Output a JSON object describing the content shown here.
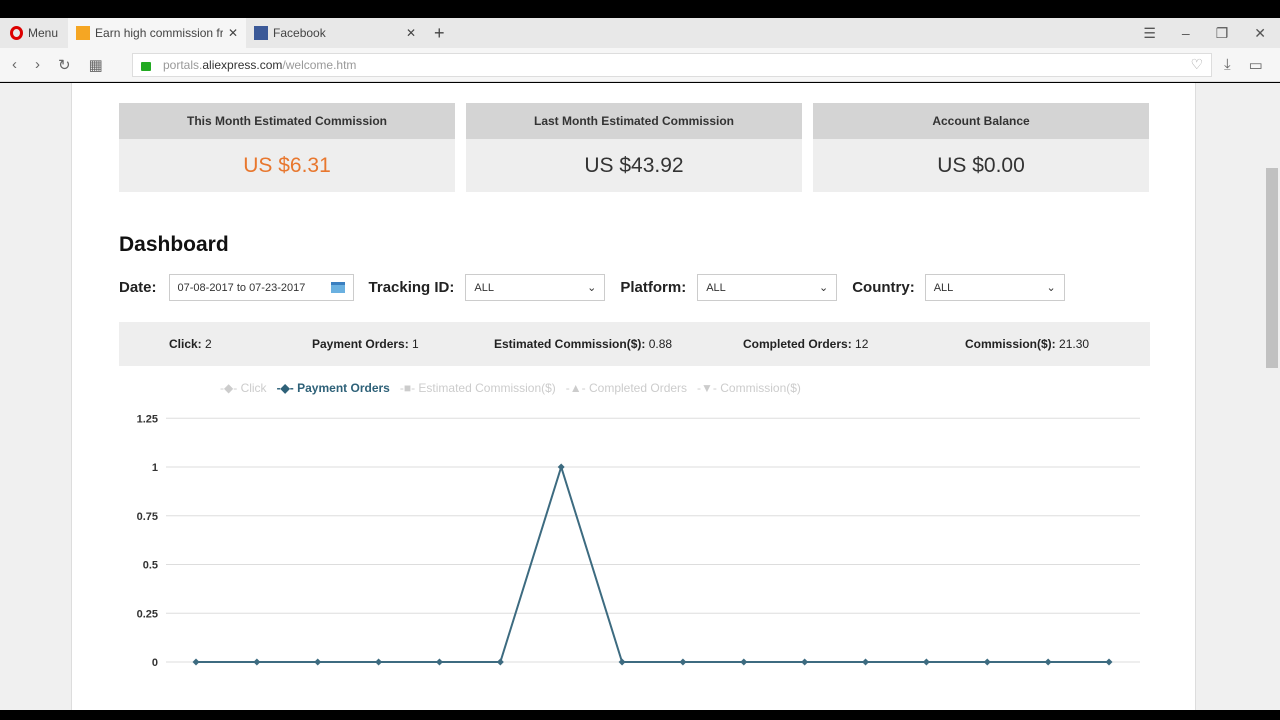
{
  "browser": {
    "menu_label": "Menu",
    "tabs": [
      {
        "title": "Earn high commission from",
        "active": true
      },
      {
        "title": "Facebook",
        "active": false
      }
    ],
    "url_prefix": "portals.",
    "url_domain": "aliexpress.com",
    "url_path": "/welcome.htm"
  },
  "cards": [
    {
      "title": "This Month Estimated Commission",
      "value": "US $6.31",
      "color": "#e8772e"
    },
    {
      "title": "Last Month Estimated Commission",
      "value": "US $43.92",
      "color": "#333333"
    },
    {
      "title": "Account Balance",
      "value": "US $0.00",
      "color": "#333333"
    }
  ],
  "dashboard": {
    "title": "Dashboard",
    "filters": {
      "date_label": "Date:",
      "date_value": "07-08-2017 to 07-23-2017",
      "tracking_label": "Tracking ID:",
      "tracking_value": "ALL",
      "platform_label": "Platform:",
      "platform_value": "ALL",
      "country_label": "Country:",
      "country_value": "ALL"
    },
    "stats": [
      {
        "label": "Click:",
        "value": "2"
      },
      {
        "label": "Payment Orders:",
        "value": "1"
      },
      {
        "label": "Estimated Commission($):",
        "value": "0.88"
      },
      {
        "label": "Completed Orders:",
        "value": "12"
      },
      {
        "label": "Commission($):",
        "value": "21.30"
      }
    ]
  },
  "chart_data": {
    "type": "line",
    "legend": [
      "Click",
      "Payment Orders",
      "Estimated Commission($)",
      "Completed Orders",
      "Commission($)"
    ],
    "active_series": "Payment Orders",
    "legend_placement": "top",
    "series": [
      {
        "name": "Payment Orders",
        "values": [
          0,
          0,
          0,
          0,
          0,
          0,
          1,
          0,
          0,
          0,
          0,
          0,
          0,
          0,
          0,
          0
        ],
        "color": "#3d6b80"
      }
    ],
    "yticks": [
      "1.25",
      "1",
      "0.75",
      "0.5",
      "0.25",
      "0"
    ],
    "ylim": [
      -0.25,
      1.25
    ],
    "grid": true
  }
}
